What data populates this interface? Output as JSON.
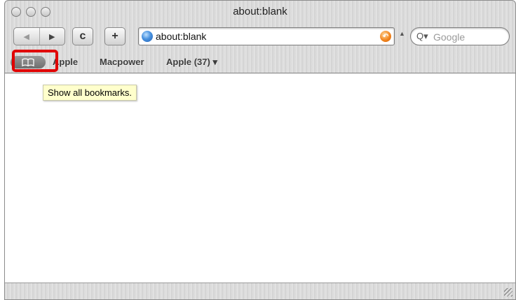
{
  "window": {
    "title": "about:blank"
  },
  "toolbar": {
    "back_icon": "◀",
    "forward_icon": "▶",
    "reload_icon": "c",
    "add_icon": "+",
    "url": "about:blank",
    "search_placeholder": "Google"
  },
  "bookmarks_bar": {
    "items": [
      {
        "label": "Apple"
      },
      {
        "label": "Macpower"
      },
      {
        "label": "Apple (37) ▾"
      }
    ]
  },
  "tooltip": {
    "text": "Show all bookmarks."
  },
  "colors": {
    "highlight": "#e00000",
    "tooltip_bg": "#ffffcc"
  }
}
